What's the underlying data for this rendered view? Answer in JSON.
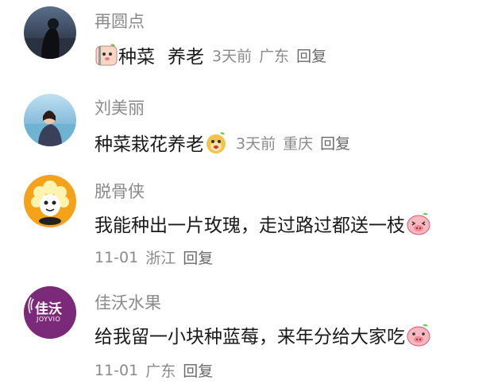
{
  "comments": [
    {
      "user": "再圆点",
      "text_part1": "种菜",
      "text_part2": "养老",
      "time": "3天前",
      "location": "广东",
      "reply_label": "回复"
    },
    {
      "user": "刘美丽",
      "text": "种菜栽花养老",
      "time": "3天前",
      "location": "重庆",
      "reply_label": "回复"
    },
    {
      "user": "脱骨侠",
      "text": "我能种出一片玫瑰，走过路过都送一枝",
      "time": "11-01",
      "location": "浙江",
      "reply_label": "回复"
    },
    {
      "user": "佳沃水果",
      "avatar_logo": "佳沃",
      "avatar_sub": "JOYVIO",
      "text": "给我留一小块种蓝莓，来年分给大家吃",
      "time": "11-01",
      "location": "广东",
      "reply_label": "回复"
    }
  ],
  "colors": {
    "name": "#8a8a8a",
    "text": "#1a1a1a",
    "meta": "#8a8a8a",
    "joyvio_purple": "#7b2a7a"
  }
}
